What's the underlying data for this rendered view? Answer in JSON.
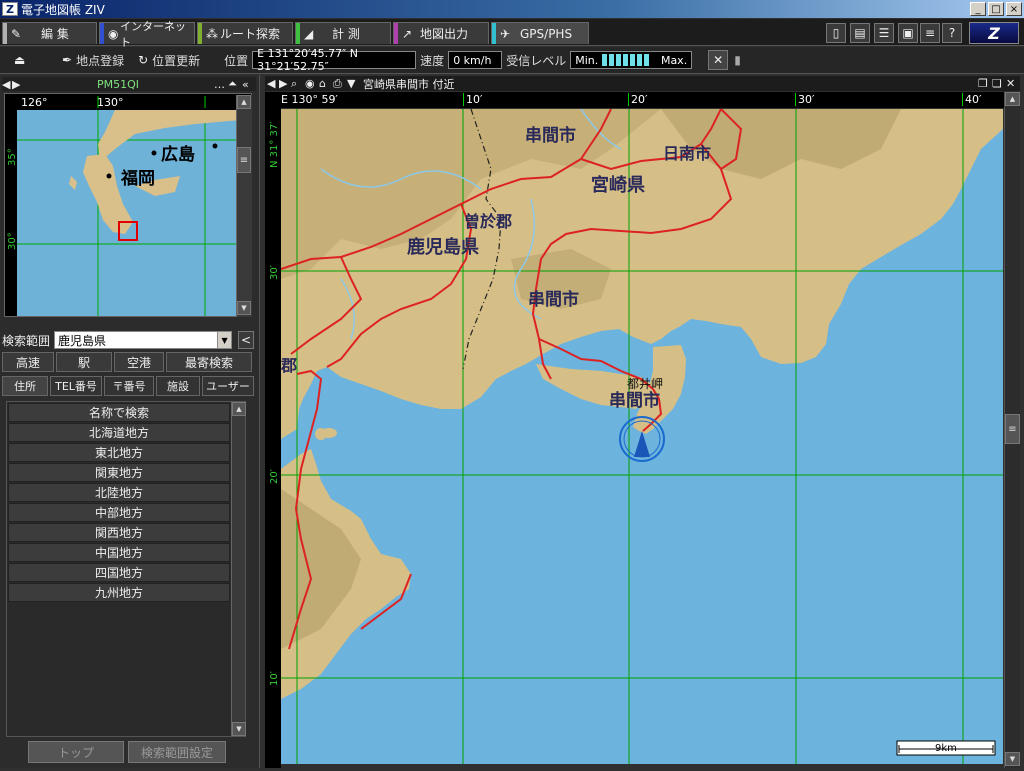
{
  "window": {
    "title": "電子地図帳 ZIV",
    "icon": "Z"
  },
  "tabs": [
    {
      "label": "編 集",
      "icon": "pencil-icon",
      "color": "#b0b0b0"
    },
    {
      "label": "インターネット",
      "icon": "globe-icon",
      "color": "#3050d0"
    },
    {
      "label": "ルート探索",
      "icon": "route-icon",
      "color": "#7fb030"
    },
    {
      "label": "計 測",
      "icon": "ruler-icon",
      "color": "#40c040"
    },
    {
      "label": "地図出力",
      "icon": "output-icon",
      "color": "#b040b0"
    },
    {
      "label": "GPS/PHS",
      "icon": "satellite-icon",
      "color": "#30c0d0"
    }
  ],
  "toolbar": {
    "register_label": "地点登録",
    "update_label": "位置更新",
    "position_label": "位置",
    "position_value": "E 131°20′45.77″ N 31°21′52.75″",
    "speed_label": "速度",
    "speed_value": "0 km/h",
    "reception_label": "受信レベル",
    "min_label": "Min.",
    "max_label": "Max.",
    "reception_bars": 7
  },
  "minimap": {
    "title": "PM51QI",
    "top_ticks": [
      "126°",
      "130°"
    ],
    "left_ticks": [
      "35°",
      "30°"
    ],
    "labels": [
      "広島",
      "福岡"
    ]
  },
  "search": {
    "label": "検索範囲",
    "value": "鹿児島県",
    "collapse": "<"
  },
  "quick_buttons": [
    "高速",
    "駅",
    "空港",
    "最寄検索"
  ],
  "category_tabs": [
    "住所",
    "TEL番号",
    "〒番号",
    "施設",
    "ユーザー"
  ],
  "regions": [
    "名称で検索",
    "北海道地方",
    "東北地方",
    "関東地方",
    "北陸地方",
    "中部地方",
    "関西地方",
    "中国地方",
    "四国地方",
    "九州地方"
  ],
  "bottom_buttons": [
    "トップ",
    "検索範囲設定"
  ],
  "map": {
    "title": "宮崎県串間市 付近",
    "top_ticks": [
      "E 130° 59′",
      "10′",
      "20′",
      "30′",
      "40′"
    ],
    "left_ticks": [
      "N 31° 37′",
      "30′",
      "20′",
      "10′"
    ],
    "scale_label": "9km",
    "labels": {
      "kushima1": "串間市",
      "nichinan": "日南市",
      "miyazaki": "宮崎県",
      "soo": "曽於郡",
      "kagoshima": "鹿児島県",
      "kushima2": "串間市",
      "toimisaki": "都井岬",
      "kushima3": "串間市",
      "gun": "郡"
    }
  },
  "colors": {
    "sea": "#6cb3dd",
    "land": "#d9c08a",
    "grid": "#00b000",
    "road": "#d02020"
  }
}
